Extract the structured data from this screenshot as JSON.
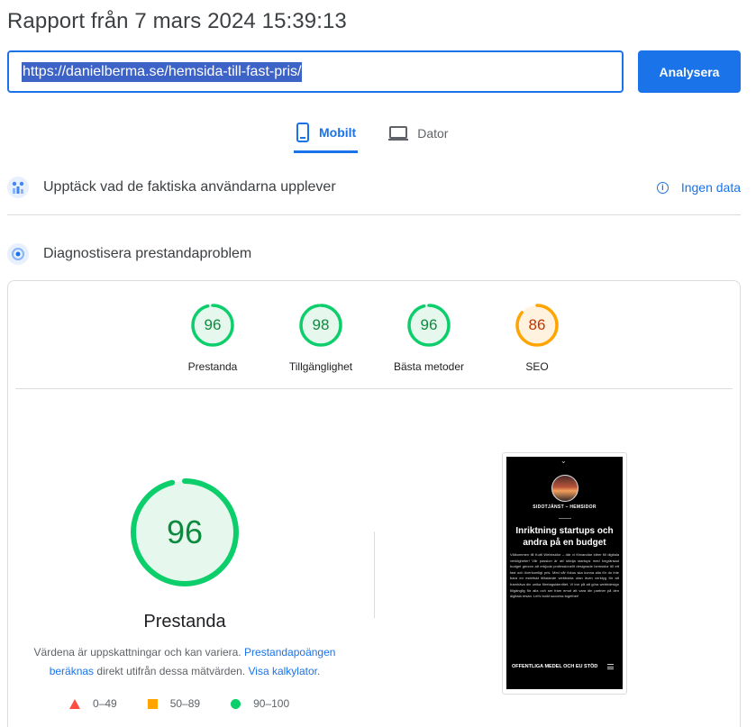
{
  "header": {
    "title": "Rapport från 7 mars 2024 15:39:13"
  },
  "search": {
    "url": "https://danielberma.se/hemsida-till-fast-pris/",
    "analyze_label": "Analysera"
  },
  "tabs": [
    {
      "label": "Mobilt",
      "icon": "smartphone-icon",
      "active": true
    },
    {
      "label": "Dator",
      "icon": "laptop-icon",
      "active": false
    }
  ],
  "sections": {
    "field": {
      "title": "Upptäck vad de faktiska användarna upplever",
      "status": "Ingen data",
      "icon": "users-chart-icon"
    },
    "lab": {
      "title": "Diagnostisera prestandaproblem",
      "icon": "lighthouse-icon"
    }
  },
  "scores": [
    {
      "value": "96",
      "label": "Prestanda",
      "color": "#0cce6b",
      "text_color": "#0d8a3e",
      "fraction": 0.96
    },
    {
      "value": "98",
      "label": "Tillgänglighet",
      "color": "#0cce6b",
      "text_color": "#0d8a3e",
      "fraction": 0.98
    },
    {
      "value": "96",
      "label": "Bästa metoder",
      "color": "#0cce6b",
      "text_color": "#0d8a3e",
      "fraction": 0.96
    },
    {
      "value": "86",
      "label": "SEO",
      "color": "#ffa400",
      "text_color": "#c33300",
      "fraction": 0.86
    }
  ],
  "performance": {
    "value": "96",
    "fraction": 0.96,
    "label": "Prestanda",
    "note_text_1": "Värdena är uppskattningar och kan variera. ",
    "note_link_1": "Prestandapoängen beräknas",
    "note_text_2": " direkt utifrån dessa mätvärden. ",
    "note_link_2": "Visa kalkylator",
    "note_text_3": "."
  },
  "legend": [
    {
      "range": "0–49",
      "shape": "triangle",
      "color": "#ff4e42"
    },
    {
      "range": "50–89",
      "shape": "square",
      "color": "#ffa400"
    },
    {
      "range": "90–100",
      "shape": "circle",
      "color": "#0cce6b"
    }
  ],
  "screenshot": {
    "subtitle": "SIDOTJÄNST – HEMSIDOR",
    "headline": "Inriktning startups och andra på en budget",
    "paragraph": "Välkommen till Kutti Webbsidor – där vi förvandlar idéer till digitala verkligheter! Vår passion är att stödja startups med begränsad budget genom att erbjuda professionellt designade hemsidor till ett fast och överkomligt pris. Med vår fokus ska kunna alla för du inte bara en estetiskt tilltalande webbsida utan även verktyg för att framhäva din unika företagsidentitet. Vi tror på att göra webbdesign tillgänglig för alla och ser fram emot att vara din partner på den digitala resan. Let's build success together!",
    "footer": "OFFENTLIGA MEDEL OCH EU STÖD"
  }
}
